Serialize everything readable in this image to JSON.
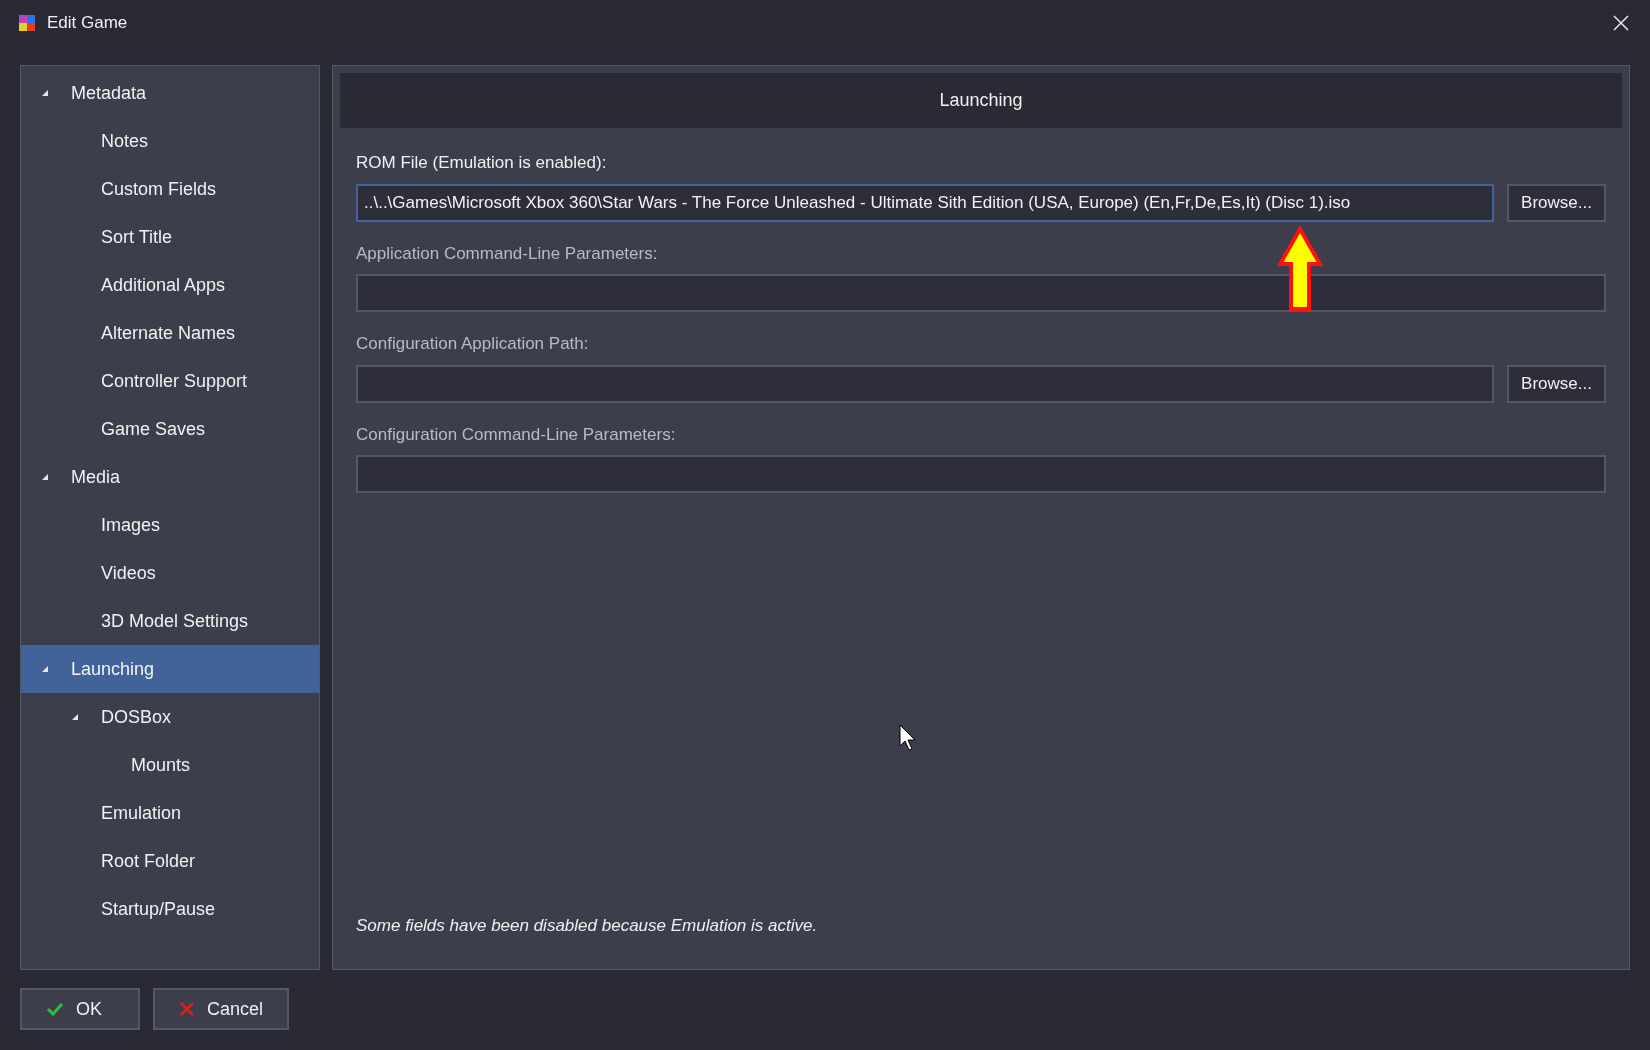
{
  "window": {
    "title": "Edit Game"
  },
  "sidebar": {
    "items": [
      {
        "label": "Metadata",
        "selected": false,
        "expanded": true,
        "children": [
          {
            "label": "Notes",
            "selected": false
          },
          {
            "label": "Custom Fields",
            "selected": false
          },
          {
            "label": "Sort Title",
            "selected": false
          },
          {
            "label": "Additional Apps",
            "selected": false
          },
          {
            "label": "Alternate Names",
            "selected": false
          },
          {
            "label": "Controller Support",
            "selected": false
          },
          {
            "label": "Game Saves",
            "selected": false
          }
        ]
      },
      {
        "label": "Media",
        "selected": false,
        "expanded": true,
        "children": [
          {
            "label": "Images",
            "selected": false
          },
          {
            "label": "Videos",
            "selected": false
          },
          {
            "label": "3D Model Settings",
            "selected": false
          }
        ]
      },
      {
        "label": "Launching",
        "selected": true,
        "expanded": true,
        "children": [
          {
            "label": "DOSBox",
            "selected": false,
            "expanded": true,
            "children": [
              {
                "label": "Mounts",
                "selected": false
              }
            ]
          },
          {
            "label": "Emulation",
            "selected": false
          },
          {
            "label": "Root Folder",
            "selected": false
          },
          {
            "label": "Startup/Pause",
            "selected": false
          }
        ]
      }
    ]
  },
  "panel": {
    "title": "Launching",
    "fields": [
      {
        "label": "ROM File (Emulation is enabled):",
        "value": "..\\..\\Games\\Microsoft Xbox 360\\Star Wars - The Force Unleashed - Ultimate Sith Edition (USA, Europe) (En,Fr,De,Es,It) (Disc 1).iso",
        "disabled": false,
        "focused": true,
        "browse": "Browse..."
      },
      {
        "label": "Application Command-Line Parameters:",
        "disabled": true,
        "focused": false
      },
      {
        "label": "Configuration Application Path:",
        "disabled": true,
        "focused": false,
        "browse": "Browse..."
      },
      {
        "label": "Configuration Command-Line Parameters:",
        "disabled": true,
        "focused": false
      }
    ],
    "note": "Some fields have been disabled because Emulation is active."
  },
  "buttons": [
    {
      "kind": "ok",
      "label": "OK"
    },
    {
      "kind": "cancel",
      "label": "Cancel"
    }
  ]
}
